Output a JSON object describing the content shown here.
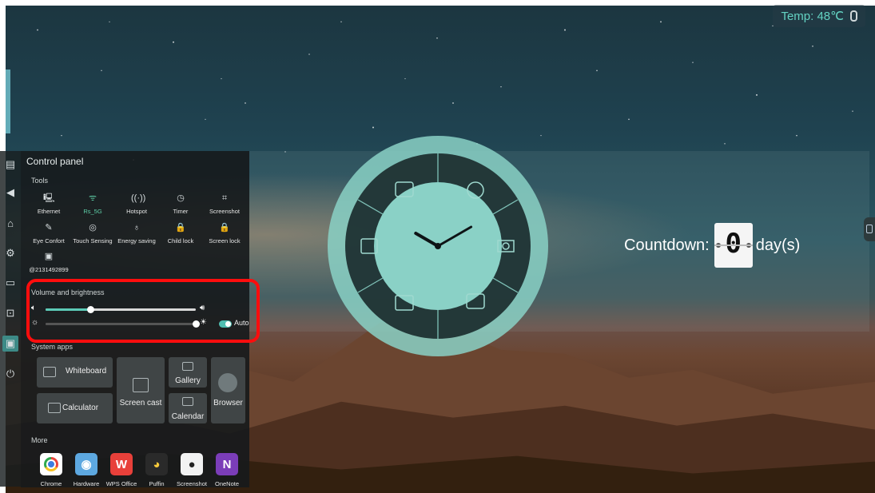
{
  "status": {
    "temperature": "Temp: 48℃"
  },
  "countdown": {
    "label": "Countdown:",
    "value": "0",
    "unit": "day(s)"
  },
  "clock": {
    "hour_hand_angle_deg": 300,
    "minute_hand_angle_deg": 60,
    "shortcut_icons": [
      "whiteboard-icon",
      "browser-icon",
      "settings-icon",
      "screencast-icon",
      "calculator-icon",
      "calendar-icon"
    ]
  },
  "sidebar": {
    "items": [
      "control-panel-icon",
      "back-icon",
      "home-icon",
      "settings-icon",
      "folder-icon",
      "input-source-icon",
      "screen-icon",
      "power-icon"
    ]
  },
  "panel": {
    "title": "Control panel",
    "tools_label": "Tools",
    "tools": [
      {
        "label": "Ethernet",
        "icon": "ethernet-icon",
        "glyph": "🖳"
      },
      {
        "label": "Rs_5G",
        "icon": "wifi-icon",
        "glyph": "ᯤ",
        "active": true
      },
      {
        "label": "Hotspot",
        "icon": "hotspot-icon",
        "glyph": "((·))"
      },
      {
        "label": "Timer",
        "icon": "timer-icon",
        "glyph": "◷"
      },
      {
        "label": "Screenshot",
        "icon": "screenshot-icon",
        "glyph": "⌗"
      },
      {
        "label": "Eye Confort",
        "icon": "eye-comfort-icon",
        "glyph": "✎"
      },
      {
        "label": "Touch Sensing",
        "icon": "touch-icon",
        "glyph": "◎"
      },
      {
        "label": "Energy saving",
        "icon": "energy-icon",
        "glyph": "♁"
      },
      {
        "label": "Child lock",
        "icon": "child-lock-icon",
        "glyph": "🔒"
      },
      {
        "label": "Screen lock",
        "icon": "screen-lock-icon",
        "glyph": "🔒"
      },
      {
        "label": "@2131492899",
        "icon": "unknown-tool-icon",
        "glyph": "▣"
      }
    ],
    "volume_brightness_label": "Volume and brightness",
    "volume_level": 0.3,
    "brightness_level": 1.0,
    "auto_label": "Auto",
    "auto_enabled": true,
    "system_apps_label": "System apps",
    "system_apps": {
      "whiteboard": "Whiteboard",
      "calculator": "Calculator",
      "screen_cast": "Screen cast",
      "gallery": "Gallery",
      "calendar": "Calendar",
      "browser": "Browser"
    },
    "more_label": "More",
    "more_apps": [
      {
        "label": "Chrome",
        "icon": "chrome-icon",
        "color": "#e8453c"
      },
      {
        "label": "Hardware",
        "icon": "hardware-icon",
        "color": "#5da8e0"
      },
      {
        "label": "WPS Office",
        "icon": "wps-office-icon",
        "color": "#e8403a"
      },
      {
        "label": "Puffin",
        "icon": "puffin-icon",
        "color": "#2a2a2a"
      },
      {
        "label": "Screenshot",
        "icon": "screenshot-app-icon",
        "color": "#f2f2f2"
      },
      {
        "label": "OneNote",
        "icon": "onenote-icon",
        "color": "#7b3db8"
      }
    ]
  },
  "colors": {
    "accent": "#5ccbb8",
    "highlight": "#ff0d0d"
  }
}
